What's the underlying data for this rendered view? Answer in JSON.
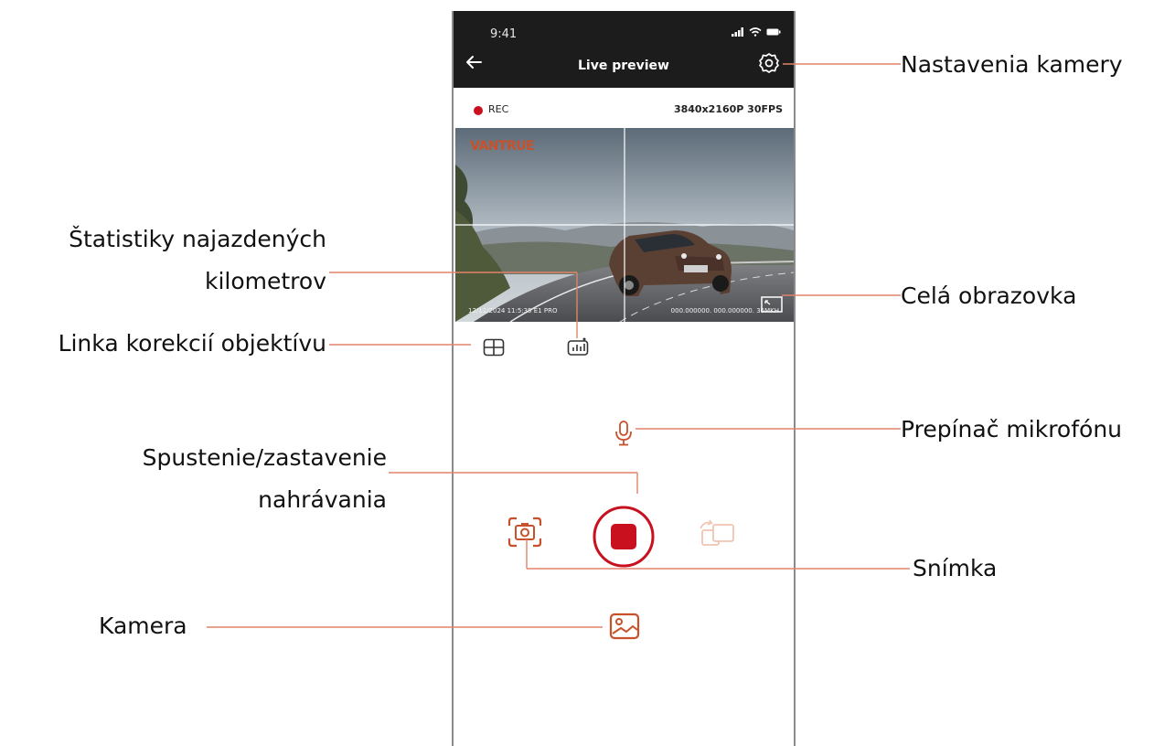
{
  "status_bar": {
    "time": "9:41"
  },
  "header": {
    "title": "Live preview"
  },
  "recording": {
    "label": "REC",
    "resolution": "3840x2160P 30FPS"
  },
  "preview": {
    "brand": "VANTRUE",
    "overlay_left": "12/11/2024  11:5:35  E1 PRO",
    "overlay_right": "000.000000.  000.000000.  36MKH"
  },
  "annotations": {
    "camera_settings": "Nastavenia kamery",
    "mileage_stats_line1": "Štatistiky najazdených",
    "mileage_stats_line2": "kilometrov",
    "fullscreen": "Celá obrazovka",
    "lens_correction": "Linka korekcií objektívu",
    "mic_toggle": "Prepínač mikrofónu",
    "record_line1": "Spustenie/zastavenie",
    "record_line2": "nahrávania",
    "snapshot": "Snímka",
    "gallery": "Kamera"
  },
  "colors": {
    "accent": "#c8512b",
    "record_red": "#c8101e",
    "header_bg": "#1c1c1c",
    "annotation_line": "#e0836a"
  },
  "icons": [
    "back-arrow-icon",
    "gear-icon",
    "signal-icon",
    "wifi-icon",
    "battery-icon",
    "fullscreen-icon",
    "grid-icon",
    "stats-chart-icon",
    "microphone-icon",
    "camera-capture-icon",
    "record-stop-icon",
    "switch-camera-icon",
    "gallery-icon"
  ]
}
